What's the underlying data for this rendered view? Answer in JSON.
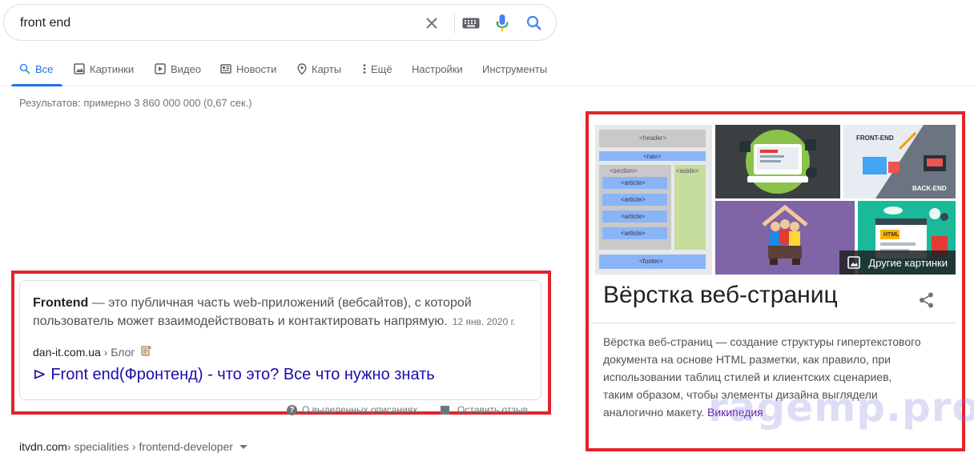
{
  "search": {
    "query": "front end",
    "icons": [
      "close-icon",
      "keyboard-icon",
      "mic-icon",
      "search-icon"
    ]
  },
  "tabs": [
    {
      "label": "Все",
      "icon": "search-icon",
      "active": true
    },
    {
      "label": "Картинки",
      "icon": "image-icon"
    },
    {
      "label": "Видео",
      "icon": "video-icon"
    },
    {
      "label": "Новости",
      "icon": "news-icon"
    },
    {
      "label": "Карты",
      "icon": "map-pin-icon"
    },
    {
      "label": "Ещё",
      "icon": "more-vert-icon"
    },
    {
      "label": "Настройки"
    },
    {
      "label": "Инструменты"
    }
  ],
  "results_stats": "Результатов: примерно 3 860 000 000 (0,67 сек.)",
  "featured_snippet": {
    "term": "Frontend",
    "text": " — это публичная часть web-приложений (вебсайтов), с которой пользователь может взаимодействовать и контактировать напрямую.",
    "date": "12 янв. 2020 г.",
    "site": "dan-it.com.ua",
    "breadcrumb": " › Блог",
    "link_title": "⊳ Front end(Фронтенд) - что это? Все что нужно знать"
  },
  "feedback": {
    "snippets_label": "О выделенных описаниях",
    "report_label": "Оставить отзыв"
  },
  "next_result": {
    "site": "itvdn.com",
    "breadcrumb": " › specialities › frontend-developer"
  },
  "knowledge_panel": {
    "more_images_label": "Другие картинки",
    "title": "Вёрстка веб-страниц",
    "description": "Вёрстка веб-страниц — создание структуры гипертекстового документа на основе HTML разметки, как правило, при использовании таблиц стилей и клиентских сценариев, таким образом, чтобы элементы дизайна выглядели аналогично макету.",
    "source": "Википедия",
    "image1_labels": {
      "header": "<header>",
      "nav": "<nav>",
      "section": "<section>",
      "aside": "<aside>",
      "article": "<article>",
      "footer": "<footer>"
    },
    "image3_labels": {
      "top": "FRONT-END",
      "bottom": "BACK-END"
    },
    "image5_label": "HTML"
  },
  "watermark": "ragemp.pro",
  "colors": {
    "accent": "#1a73e8",
    "link": "#1a0dab",
    "visited": "#681da8",
    "highlight_box": "#e3242b"
  }
}
